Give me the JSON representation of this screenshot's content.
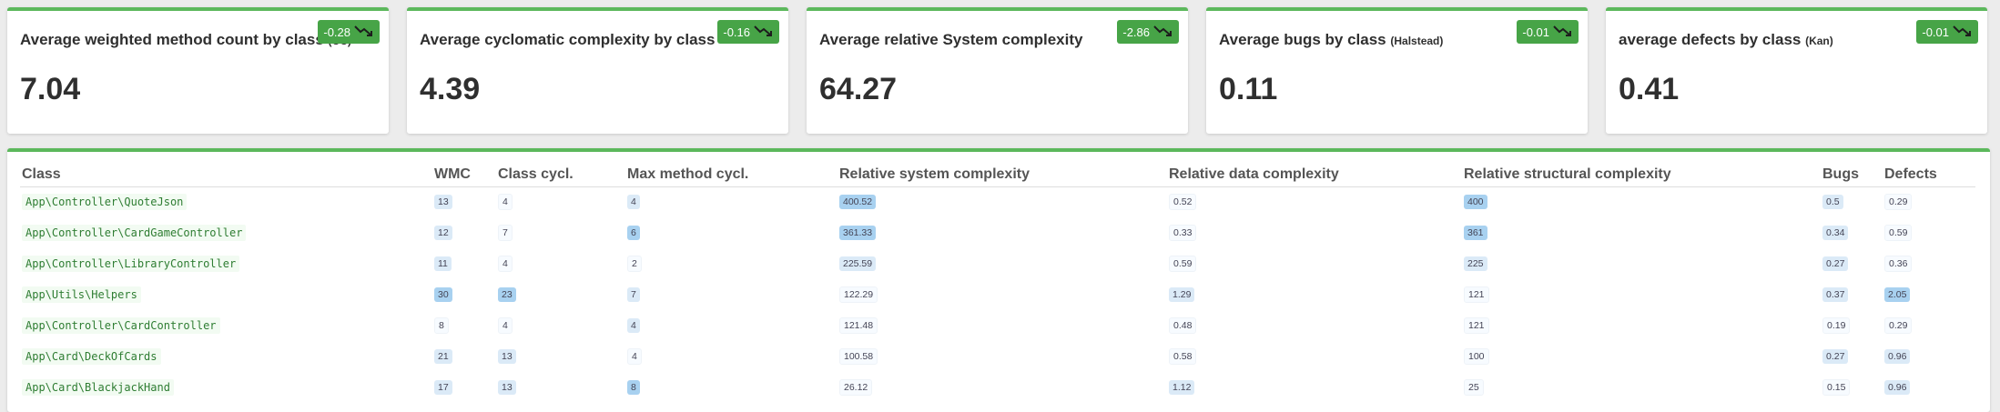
{
  "cards": [
    {
      "title": "Average weighted method count by class",
      "title_suffix": "(CC)",
      "value": "7.04",
      "delta": "-0.28",
      "trend_icon": "trend-down-icon"
    },
    {
      "title": "Average cyclomatic complexity by class",
      "title_suffix": "",
      "value": "4.39",
      "delta": "-0.16",
      "trend_icon": "trend-down-icon"
    },
    {
      "title": "Average relative System complexity",
      "title_suffix": "",
      "value": "64.27",
      "delta": "-2.86",
      "trend_icon": "trend-down-icon"
    },
    {
      "title": "Average bugs by class",
      "title_suffix": "(Halstead)",
      "value": "0.11",
      "delta": "-0.01",
      "trend_icon": "trend-down-icon"
    },
    {
      "title": "average defects by class",
      "title_suffix": "(Kan)",
      "value": "0.41",
      "delta": "-0.01",
      "trend_icon": "trend-down-icon"
    }
  ],
  "colors": {
    "accent": "#5cb85c",
    "badge": "#47a447",
    "class_text": "#2e7d32"
  },
  "table": {
    "headers": [
      "Class",
      "WMC",
      "Class cycl.",
      "Max method cycl.",
      "Relative system complexity",
      "Relative data complexity",
      "Relative structural complexity",
      "Bugs",
      "Defects"
    ],
    "rows": [
      {
        "cells": [
          "App\\Controller\\QuoteJson",
          "13",
          "4",
          "4",
          "400.52",
          "0.52",
          "400",
          "0.5",
          "0.29"
        ],
        "levels": [
          null,
          1,
          0,
          1,
          2,
          0,
          2,
          1,
          0
        ]
      },
      {
        "cells": [
          "App\\Controller\\CardGameController",
          "12",
          "7",
          "6",
          "361.33",
          "0.33",
          "361",
          "0.34",
          "0.59"
        ],
        "levels": [
          null,
          1,
          0,
          2,
          2,
          0,
          2,
          1,
          0
        ]
      },
      {
        "cells": [
          "App\\Controller\\LibraryController",
          "11",
          "4",
          "2",
          "225.59",
          "0.59",
          "225",
          "0.27",
          "0.36"
        ],
        "levels": [
          null,
          1,
          0,
          0,
          1,
          0,
          1,
          1,
          0
        ]
      },
      {
        "cells": [
          "App\\Utils\\Helpers",
          "30",
          "23",
          "7",
          "122.29",
          "1.29",
          "121",
          "0.37",
          "2.05"
        ],
        "levels": [
          null,
          2,
          2,
          1,
          0,
          1,
          0,
          1,
          2
        ]
      },
      {
        "cells": [
          "App\\Controller\\CardController",
          "8",
          "4",
          "4",
          "121.48",
          "0.48",
          "121",
          "0.19",
          "0.29"
        ],
        "levels": [
          null,
          0,
          0,
          1,
          0,
          0,
          0,
          0,
          0
        ]
      },
      {
        "cells": [
          "App\\Card\\DeckOfCards",
          "21",
          "13",
          "4",
          "100.58",
          "0.58",
          "100",
          "0.27",
          "0.96"
        ],
        "levels": [
          null,
          1,
          1,
          0,
          0,
          0,
          0,
          1,
          1
        ]
      },
      {
        "cells": [
          "App\\Card\\BlackjackHand",
          "17",
          "13",
          "8",
          "26.12",
          "1.12",
          "25",
          "0.15",
          "0.96"
        ],
        "levels": [
          null,
          1,
          1,
          2,
          0,
          1,
          0,
          0,
          1
        ]
      }
    ]
  }
}
